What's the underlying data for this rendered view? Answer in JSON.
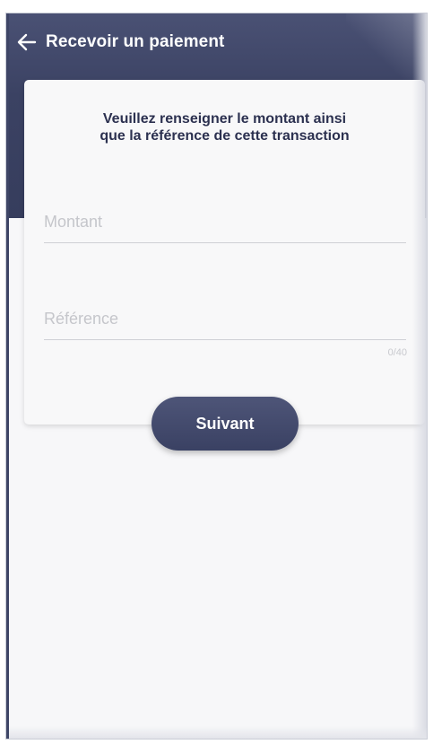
{
  "header": {
    "title": "Recevoir un paiement",
    "back_icon": "arrow-left-icon"
  },
  "form": {
    "instructions_line1": "Veuillez renseigner le montant ainsi",
    "instructions_line2": "que la référence de cette transaction",
    "amount_placeholder": "Montant",
    "amount_value": "",
    "reference_placeholder": "Référence",
    "reference_value": "",
    "reference_counter": "0/40",
    "next_label": "Suivant"
  },
  "colors": {
    "header": "#3b4263",
    "accent": "#434a6d",
    "background": "#f7f7f9"
  }
}
